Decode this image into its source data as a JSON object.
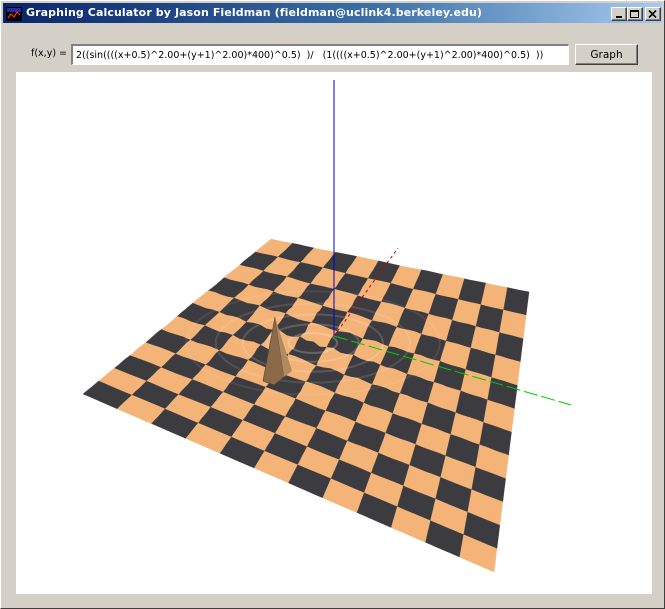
{
  "window": {
    "title": "Graphing Calculator by Jason Fieldman (fieldman@uclink4.berkeley.edu)",
    "buttons": [
      "minimize-icon",
      "maximize-icon",
      "close-icon"
    ]
  },
  "formula": {
    "label": "f(x,y) =",
    "value": "2((sin((((x+0.5)^2.00+(y+1)^2.00)*400)^0.5)  )/   (1((((x+0.5)^2.00+(y+1)^2.00)*400)^0.5)  ))",
    "graph_button_label": "Graph"
  },
  "plot": {
    "surface_colors": {
      "light": "#f4b477",
      "dark": "#3c3c40"
    },
    "axis_colors": {
      "z": "#0000cc",
      "y": "#00cc00",
      "x": "#cc0000"
    },
    "peak_color": "#8a6a48",
    "grid": "checkerboard"
  }
}
